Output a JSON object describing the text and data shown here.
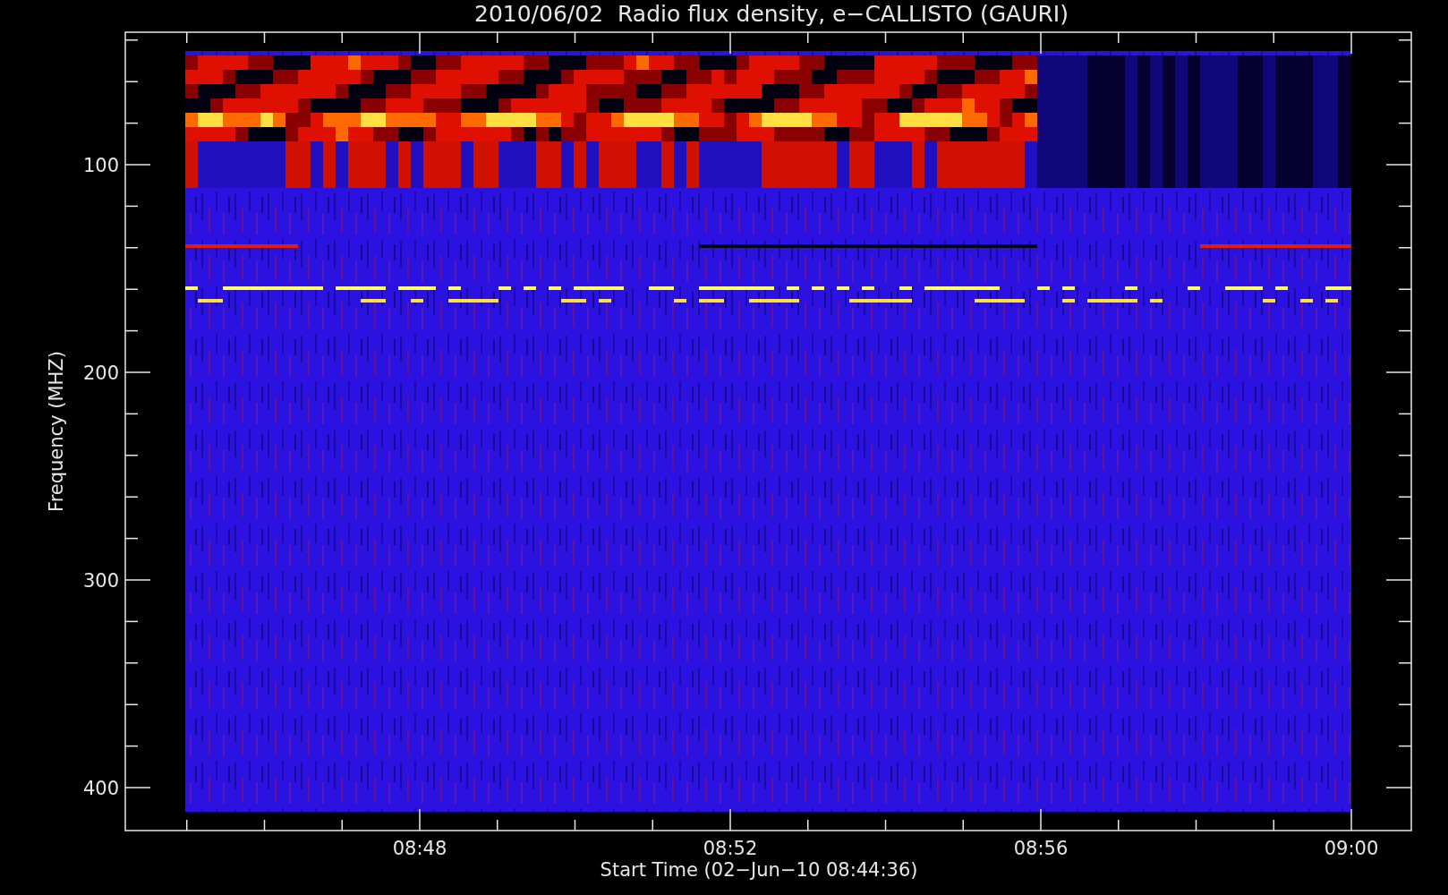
{
  "title": "2010/06/02  Radio flux density, e−CALLISTO (GAURI)",
  "y_axis": {
    "label": "Frequency (MHZ)",
    "ticks": [
      "100",
      "200",
      "300",
      "400"
    ]
  },
  "x_axis": {
    "label": "Start Time (02−Jun−10 08:44:36)",
    "ticks": [
      "08:48",
      "08:52",
      "08:56",
      "09:00"
    ]
  }
}
